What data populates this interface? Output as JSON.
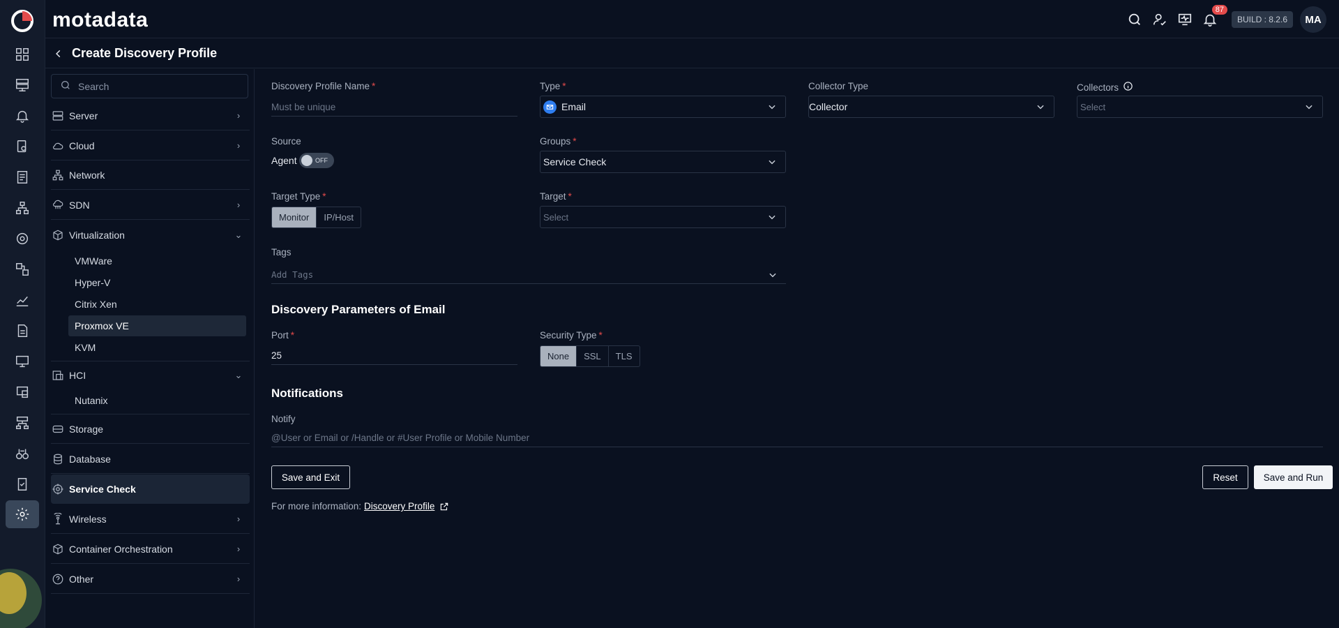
{
  "app": {
    "brand": "motadata"
  },
  "topbar": {
    "notification_count": "87",
    "build": "BUILD : 8.2.6",
    "avatar_initials": "MA"
  },
  "page": {
    "title": "Create Discovery Profile"
  },
  "sidebar": {
    "search_placeholder": "Search",
    "items": [
      {
        "label": "Server",
        "icon": "server-icon"
      },
      {
        "label": "Cloud",
        "icon": "cloud-icon"
      },
      {
        "label": "Network",
        "icon": "network-icon"
      },
      {
        "label": "SDN",
        "icon": "sdn-icon"
      },
      {
        "label": "Virtualization",
        "icon": "cube-icon"
      },
      {
        "label": "HCI",
        "icon": "hci-icon"
      },
      {
        "label": "Storage",
        "icon": "storage-icon"
      },
      {
        "label": "Database",
        "icon": "database-icon"
      },
      {
        "label": "Service Check",
        "icon": "service-check-icon"
      },
      {
        "label": "Wireless",
        "icon": "wireless-icon"
      },
      {
        "label": "Container Orchestration",
        "icon": "container-icon"
      },
      {
        "label": "Other",
        "icon": "question-icon"
      }
    ],
    "virtualization_children": [
      "VMWare",
      "Hyper-V",
      "Citrix Xen",
      "Proxmox VE",
      "KVM"
    ],
    "hci_children": [
      "Nutanix"
    ]
  },
  "form": {
    "profile_name": {
      "label": "Discovery Profile Name",
      "placeholder": "Must be unique"
    },
    "type": {
      "label": "Type",
      "value": "Email"
    },
    "collector_type": {
      "label": "Collector Type",
      "value": "Collector"
    },
    "collectors": {
      "label": "Collectors",
      "placeholder": "Select"
    },
    "source": {
      "label": "Source",
      "agent_label": "Agent",
      "toggle_state": "OFF"
    },
    "groups": {
      "label": "Groups",
      "value": "Service Check"
    },
    "target_type": {
      "label": "Target Type",
      "options": [
        "Monitor",
        "IP/Host"
      ],
      "selected": "Monitor"
    },
    "target": {
      "label": "Target",
      "placeholder": "Select"
    },
    "tags": {
      "label": "Tags",
      "placeholder": "Add Tags"
    },
    "params_title": "Discovery Parameters of Email",
    "port": {
      "label": "Port",
      "value": "25"
    },
    "security_type": {
      "label": "Security Type",
      "options": [
        "None",
        "SSL",
        "TLS"
      ],
      "selected": "None"
    },
    "notifications_title": "Notifications",
    "notify": {
      "label": "Notify",
      "placeholder": "@User or Email or /Handle or #User Profile or Mobile Number"
    },
    "buttons": {
      "save_exit": "Save and Exit",
      "reset": "Reset",
      "save_run": "Save and Run"
    },
    "more_info": {
      "text": "For more information:",
      "link": "Discovery Profile"
    }
  },
  "colors": {
    "background": "#0a1120",
    "required": "#e34b4b",
    "accent_blue": "#2f7ef0"
  }
}
